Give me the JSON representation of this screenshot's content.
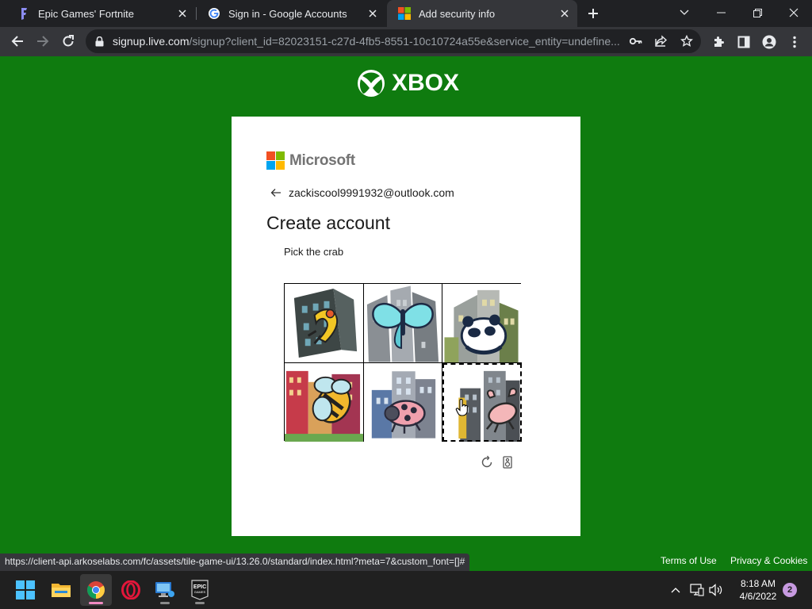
{
  "browser": {
    "tabs": [
      {
        "title": "Epic Games' Fortnite",
        "icon": "fortnite-icon"
      },
      {
        "title": "Sign in - Google Accounts",
        "icon": "google-icon"
      },
      {
        "title": "Add security info",
        "icon": "microsoft-icon",
        "active": true
      }
    ],
    "url_host": "signup.live.com",
    "url_rest": "/signup?client_id=82023151-c27d-4fb5-8551-10c10724a55e&service_entity=undefine...",
    "status_url": "https://client-api.arkoselabs.com/fc/assets/tile-game-ui/13.26.0/standard/index.html?meta=7&custom_font=[]#"
  },
  "page": {
    "brand": "XBOX",
    "ms_brand": "Microsoft",
    "identity": "zackiscool9991932@outlook.com",
    "title": "Create account",
    "captcha_prompt": "Pick the crab",
    "captcha_tiles": [
      {
        "subject": "dragon",
        "selected": false
      },
      {
        "subject": "butterfly",
        "selected": false
      },
      {
        "subject": "panda",
        "selected": false
      },
      {
        "subject": "bee",
        "selected": false
      },
      {
        "subject": "ladybug",
        "selected": false
      },
      {
        "subject": "crab",
        "selected": true
      }
    ],
    "colors": {
      "background": "#0f7b0f",
      "card": "#ffffff"
    }
  },
  "footer": {
    "terms": "Terms of Use",
    "privacy": "Privacy & Cookies"
  },
  "taskbar": {
    "apps": [
      "windows-start-icon",
      "file-explorer-icon",
      "chrome-icon",
      "opera-icon",
      "remote-desktop-icon",
      "epic-games-icon"
    ],
    "epic_label": "EPIC",
    "epic_sublabel": "GAMES",
    "time": "8:18 AM",
    "date": "4/6/2022",
    "notifications": "2"
  }
}
